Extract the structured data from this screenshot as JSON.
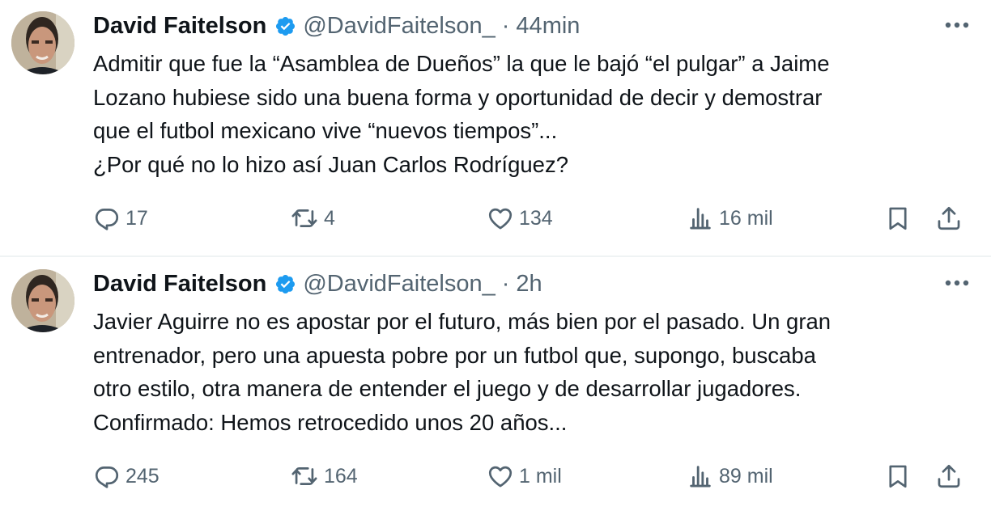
{
  "tweets": [
    {
      "author": "David Faitelson",
      "handle": "@DavidFaitelson_",
      "time": "· 44min",
      "lines": [
        "Admitir que fue la “Asamblea de Dueños” la que le bajó “el pulgar” a Jaime",
        "Lozano hubiese sido una buena forma y oportunidad de decir y demostrar",
        "que el futbol mexicano vive “nuevos  tiempos”...",
        "¿Por qué no lo hizo así Juan Carlos Rodríguez?"
      ],
      "replies": "17",
      "retweets": "4",
      "likes": "134",
      "views": "16 mil"
    },
    {
      "author": "David Faitelson",
      "handle": "@DavidFaitelson_",
      "time": "· 2h",
      "lines": [
        "Javier Aguirre no es apostar por el futuro, más bien por el pasado. Un gran",
        "entrenador, pero una apuesta pobre por un futbol que, supongo, buscaba",
        "otro estilo, otra manera de entender el juego y de desarrollar jugadores.",
        "Confirmado: Hemos retrocedido unos 20 años..."
      ],
      "replies": "245",
      "retweets": "164",
      "likes": "1 mil",
      "views": "89 mil"
    }
  ],
  "icons": {
    "verified": "verified-badge-icon",
    "more": "more-horizontal-icon",
    "reply": "reply-icon",
    "retweet": "retweet-icon",
    "like": "heart-icon",
    "views": "views-chart-icon",
    "bookmark": "bookmark-icon",
    "share": "share-icon"
  },
  "colors": {
    "text": "#0f1419",
    "secondary": "#536471",
    "verified": "#1d9bf0",
    "divider": "#eff3f4"
  }
}
